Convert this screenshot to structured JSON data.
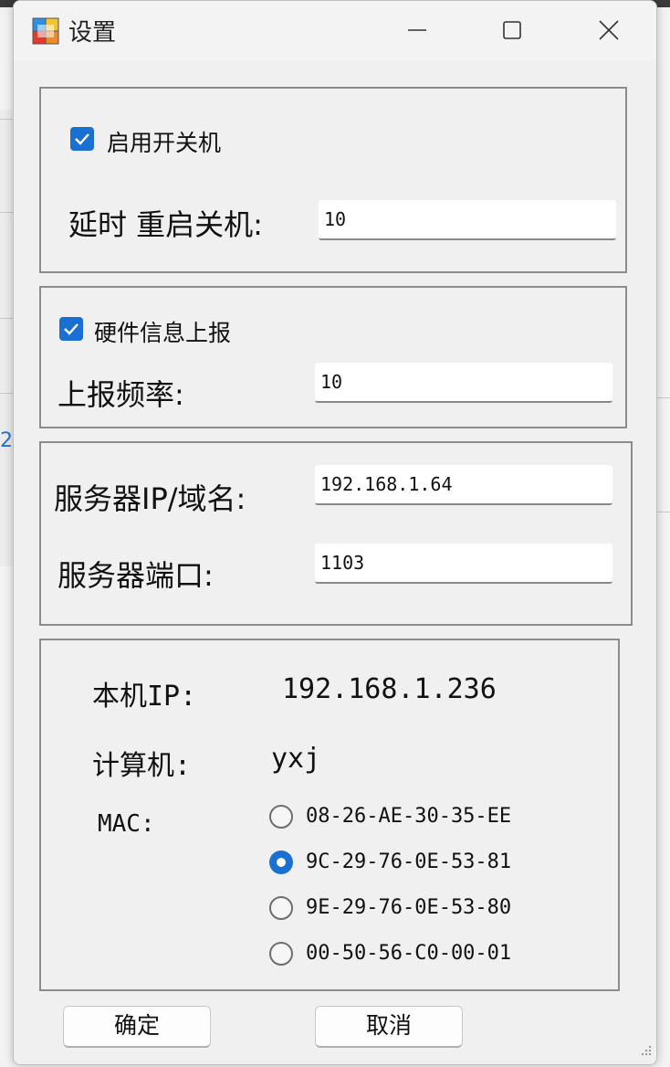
{
  "window": {
    "title": "设置",
    "app_icon": "app-icon",
    "min_icon": "minimize-icon",
    "max_icon": "maximize-icon",
    "close_icon": "close-icon"
  },
  "startup": {
    "enable_label": "启用开关机",
    "enabled": true,
    "delay_label": "延时 重启关机:",
    "delay_value": "10"
  },
  "report": {
    "enable_label": "硬件信息上报",
    "enabled": true,
    "freq_label": "上报频率:",
    "freq_value": "10"
  },
  "server": {
    "ip_label": "服务器IP/域名:",
    "ip_value": "192.168.1.64",
    "port_label": "服务器端口:",
    "port_value": "1103"
  },
  "local": {
    "ip_label": "本机IP:",
    "ip_value": "192.168.1.236",
    "computer_label": "计算机:",
    "computer_value": "yxj",
    "mac_label": "MAC:",
    "mac_options": [
      {
        "value": "08-26-AE-30-35-EE",
        "selected": false
      },
      {
        "value": "9C-29-76-0E-53-81",
        "selected": true
      },
      {
        "value": "9E-29-76-0E-53-80",
        "selected": false
      },
      {
        "value": "00-50-56-C0-00-01",
        "selected": false
      }
    ]
  },
  "buttons": {
    "ok": "确定",
    "cancel": "取消"
  },
  "background": {
    "fragment_text": "2"
  },
  "colors": {
    "accent": "#1a6fd3",
    "window_bg": "#f0f0f0",
    "group_border": "#8c8c8c"
  }
}
